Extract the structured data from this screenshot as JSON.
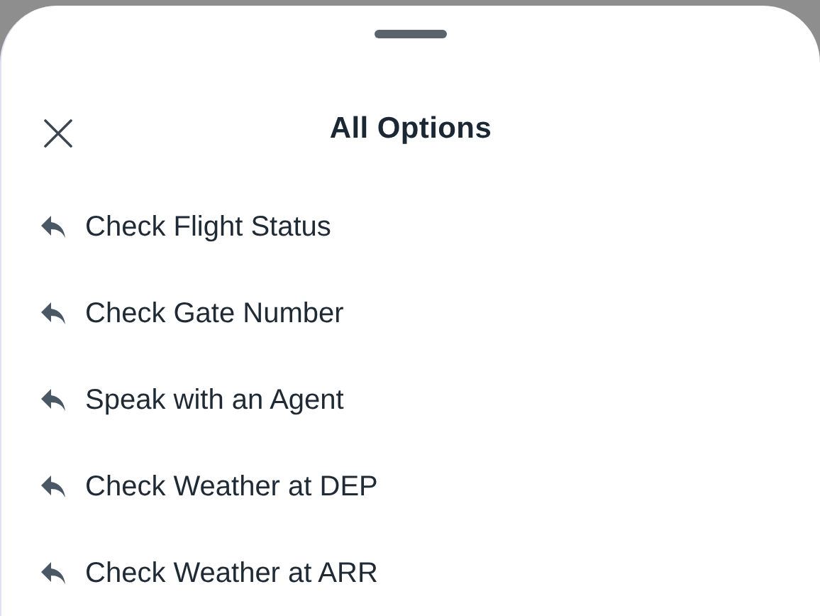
{
  "sheet": {
    "title": "All Options"
  },
  "options": [
    {
      "label": "Check Flight Status"
    },
    {
      "label": "Check Gate Number"
    },
    {
      "label": "Speak with an Agent"
    },
    {
      "label": "Check Weather at DEP"
    },
    {
      "label": "Check Weather at ARR"
    }
  ]
}
